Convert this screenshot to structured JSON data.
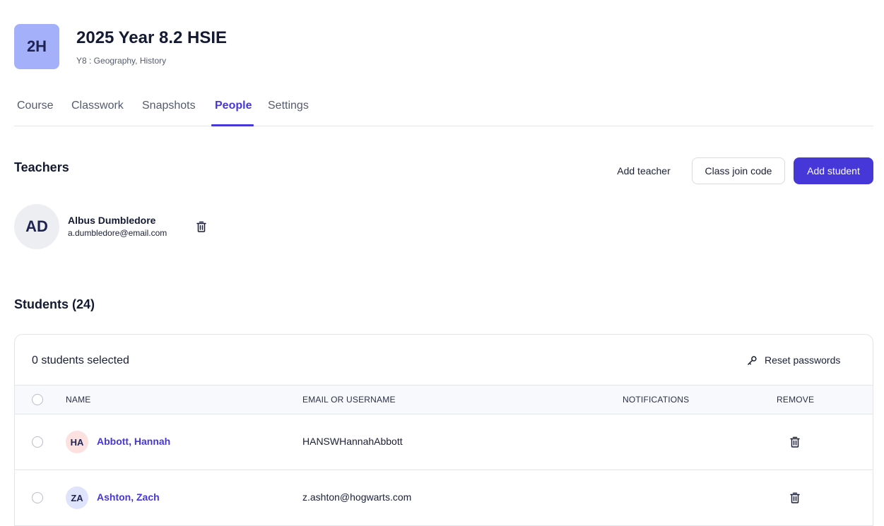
{
  "course": {
    "badge": "2H",
    "title": "2025 Year 8.2 HSIE",
    "subtitle": "Y8 : Geography, History",
    "badge_color": "#a5b0fb"
  },
  "tabs": [
    {
      "label": "Course",
      "active": false
    },
    {
      "label": "Classwork",
      "active": false
    },
    {
      "label": "Snapshots",
      "active": false
    },
    {
      "label": "People",
      "active": true
    },
    {
      "label": "Settings",
      "active": false
    }
  ],
  "accent_color": "#4637d9",
  "teachers": {
    "title": "Teachers",
    "actions": {
      "add_teacher": "Add teacher",
      "join_code": "Class join code",
      "add_student": "Add student"
    },
    "list": [
      {
        "initials": "AD",
        "name": "Albus Dumbledore",
        "email": "a.dumbledore@email.com",
        "icon": "trash-icon"
      }
    ]
  },
  "students": {
    "title": "Students (24)",
    "selected": "0 students selected",
    "reset_passwords": "Reset passwords",
    "reset_icon": "key-icon",
    "columns": {
      "name": "NAME",
      "email": "EMAIL OR USERNAME",
      "notifications": "NOTIFICATIONS",
      "remove": "REMOVE"
    },
    "rows": [
      {
        "initials": "HA",
        "name": "Abbott, Hannah",
        "email": "HANSWHannahAbbott",
        "avatar_color": "#fde0e0"
      },
      {
        "initials": "ZA",
        "name": "Ashton, Zach",
        "email": "z.ashton@hogwarts.com",
        "avatar_color": "#dfe3fb"
      }
    ]
  }
}
